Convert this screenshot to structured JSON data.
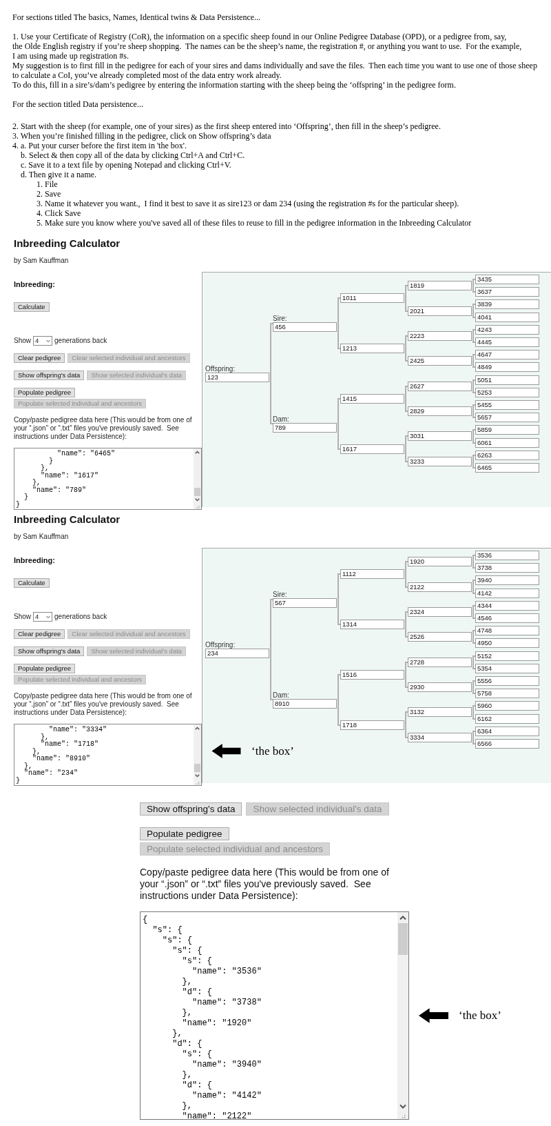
{
  "intro": {
    "heading": "For sections titled The basics, Names, Identical twins & Data Persistence...",
    "paragraphs": [
      [
        "1. Use your Certificate of Registry (CoR), the information on a specific sheep found in our Online Pedigree Database (OPD), or a pedigree from, say,",
        "the Olde English registry if you’re sheep shopping.  The names can be the sheep’s name, the registration #, or anything you want to use.  For the example,",
        "I am using made up registration #s."
      ],
      [
        "My suggestion is to first fill in the pedigree for each of your sires and dams individually and save the files.  Then each time you want to use one of those sheep",
        "to calculate a CoI, you’ve already completed most of the data entry work already."
      ],
      [
        "To do this, fill in a sire’s/dam’s pedigree by entering the information starting with the sheep being the ‘offspring’ in the pedigree form."
      ]
    ],
    "section_heading": "For the section titled Data persistence...",
    "steps": [
      {
        "text": "2. Start with the sheep (for example, one of your sires) as the first sheep entered into ‘Offspring’, then fill in the sheep’s pedigree."
      },
      {
        "text": "3. When you’re finished filling in the pedigree, click on Show offspring’s data"
      },
      {
        "text": "4. a. Put your curser before the first item in 'the box'.",
        "children": [
          {
            "text": "b. Select & then copy all of the data by clicking Ctrl+A and Ctrl+C."
          },
          {
            "text": "c. Save it to a text file by opening Notepad and clicking Ctrl+V."
          },
          {
            "text": "d. Then give it a name.",
            "children": [
              {
                "text": "1. File"
              },
              {
                "text": "2. Save"
              },
              {
                "text": "3. Name it whatever you want.,  I find it best to save it as sire123 or dam 234 (using the registration #s for the particular sheep)."
              },
              {
                "text": "4. Click Save"
              },
              {
                "text": "5. Make sure you know where you've saved all of these files to reuse to fill in the pedigree information in the Inbreeding Calculator"
              }
            ]
          }
        ]
      }
    ]
  },
  "calculators": [
    {
      "title": "Inbreeding Calculator",
      "byline": "by Sam Kauffman",
      "heading": "Inbreeding:",
      "calculate_button": {
        "label": "Calculate",
        "disabled": false
      },
      "generations": {
        "prefix": "Show",
        "value": "4",
        "suffix": "generations back"
      },
      "button_rows": [
        {
          "kind": "inline",
          "buttons": [
            {
              "label": "Clear pedigree",
              "disabled": false
            },
            {
              "label": "Clear selected individual and ancestors",
              "disabled": true
            }
          ]
        },
        {
          "kind": "inline",
          "buttons": [
            {
              "label": "Show offspring's data",
              "disabled": false
            },
            {
              "label": "Show selected individual's data",
              "disabled": true
            }
          ]
        },
        {
          "kind": "stacked",
          "buttons": [
            {
              "label": "Populate pedigree",
              "disabled": false
            },
            {
              "label": "Populate selected individual and ancestors",
              "disabled": true
            }
          ]
        }
      ],
      "paste_hint": "Copy/paste pedigree data here (This would be from one of your “.json” or “.txt” files you've previously saved.  See instructions under Data Persistence):",
      "data_lines": [
        "          \"name\": \"6465\"",
        "        }",
        "      },",
        "      \"name\": \"1617\"",
        "    },",
        "    \"name\": \"789\"",
        "  }",
        "}"
      ],
      "pedigree": {
        "offspring": {
          "label": "Offspring:",
          "value": "123"
        },
        "sire": {
          "label": "Sire:",
          "value": "456"
        },
        "dam": {
          "label": "Dam:",
          "value": "789"
        },
        "grandparents": [
          "1011",
          "1213",
          "1415",
          "1617"
        ],
        "great_grandparents": [
          "1819",
          "2021",
          "2223",
          "2425",
          "2627",
          "2829",
          "3031",
          "3233"
        ],
        "great_great_grandparents": [
          "3435",
          "3637",
          "3839",
          "4041",
          "4243",
          "4445",
          "4647",
          "4849",
          "5051",
          "5253",
          "5455",
          "5657",
          "5859",
          "6061",
          "6263",
          "6465"
        ]
      }
    },
    {
      "title": "Inbreeding Calculator",
      "byline": "by Sam Kauffman",
      "heading": "Inbreeding:",
      "calculate_button": {
        "label": "Calculate",
        "disabled": false
      },
      "generations": {
        "prefix": "Show",
        "value": "4",
        "suffix": "generations back"
      },
      "button_rows": [
        {
          "kind": "inline",
          "buttons": [
            {
              "label": "Clear pedigree",
              "disabled": false
            },
            {
              "label": "Clear selected individual and ancestors",
              "disabled": true
            }
          ]
        },
        {
          "kind": "inline",
          "buttons": [
            {
              "label": "Show offspring's data",
              "disabled": false
            },
            {
              "label": "Show selected individual's data",
              "disabled": true
            }
          ]
        },
        {
          "kind": "stacked",
          "buttons": [
            {
              "label": "Populate pedigree",
              "disabled": false
            },
            {
              "label": "Populate selected individual and ancestors",
              "disabled": true
            }
          ]
        }
      ],
      "paste_hint": "Copy/paste pedigree data here (This would be from one of your “.json” or “.txt” files you've previously saved.  See instructions under Data Persistence):",
      "data_lines": [
        "        \"name\": \"3334\"",
        "      },",
        "      \"name\": \"1718\"",
        "    },",
        "    \"name\": \"8910\"",
        "  },",
        "  \"name\": \"234\"",
        "}"
      ],
      "pedigree": {
        "offspring": {
          "label": "Offspring:",
          "value": "234"
        },
        "sire": {
          "label": "Sire:",
          "value": "567"
        },
        "dam": {
          "label": "Dam:",
          "value": "8910"
        },
        "grandparents": [
          "1112",
          "1314",
          "1516",
          "1718"
        ],
        "great_grandparents": [
          "1920",
          "2122",
          "2324",
          "2526",
          "2728",
          "2930",
          "3132",
          "3334"
        ],
        "great_great_grandparents": [
          "3536",
          "3738",
          "3940",
          "4142",
          "4344",
          "4546",
          "4748",
          "4950",
          "5152",
          "5354",
          "5556",
          "5758",
          "5960",
          "6162",
          "6364",
          "6566"
        ]
      },
      "annotation": "‘the box’"
    }
  ],
  "closeup": {
    "button_rows": [
      {
        "kind": "inline",
        "buttons": [
          {
            "label": "Show offspring's data",
            "disabled": false
          },
          {
            "label": "Show selected individual's data",
            "disabled": true
          }
        ]
      },
      {
        "kind": "stacked",
        "buttons": [
          {
            "label": "Populate pedigree",
            "disabled": false
          },
          {
            "label": "Populate selected individual and ancestors",
            "disabled": true
          }
        ]
      }
    ],
    "paste_hint": "Copy/paste pedigree data here (This would be from one of your “.json” or “.txt” files you've previously saved.  See instructions under Data Persistence):",
    "data_lines": [
      "{",
      "  \"s\": {",
      "    \"s\": {",
      "      \"s\": {",
      "        \"s\": {",
      "          \"name\": \"3536\"",
      "        },",
      "        \"d\": {",
      "          \"name\": \"3738\"",
      "        },",
      "        \"name\": \"1920\"",
      "      },",
      "      \"d\": {",
      "        \"s\": {",
      "          \"name\": \"3940\"",
      "        },",
      "        \"d\": {",
      "          \"name\": \"4142\"",
      "        },",
      "        \"name\": \"2122\""
    ],
    "annotation": "‘the box’"
  }
}
